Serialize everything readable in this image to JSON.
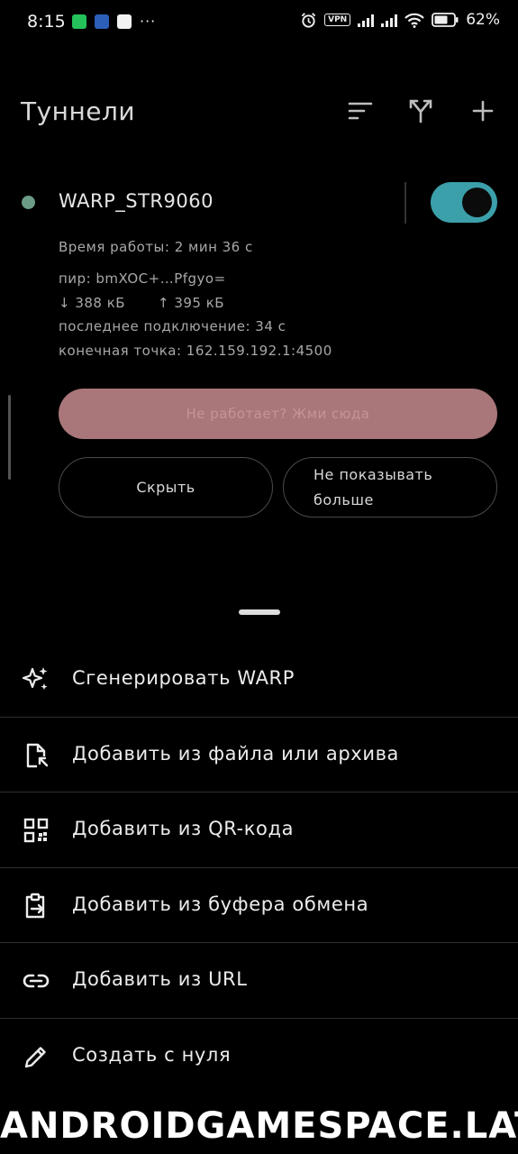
{
  "status_bar": {
    "time": "8:15",
    "notification_icons": [
      "whatsapp-icon",
      "app-icon",
      "notes-icon"
    ],
    "more": "···",
    "vpn": "VPN",
    "battery": "62%"
  },
  "header": {
    "title": "Туннели",
    "actions": [
      "sort-icon",
      "split-icon",
      "add-icon"
    ]
  },
  "tunnel": {
    "name": "WARP_STR9060",
    "status_color": "#6c9b86",
    "enabled": true,
    "uptime": "Время работы: 2 мин 36 с",
    "peer": "пир: bmXOC+…Pfgyo=",
    "rx": "↓ 388 кБ",
    "tx": "↑ 395 кБ",
    "last_handshake": "последнее подключение: 34 с",
    "endpoint": "конечная точка: 162.159.192.1:4500"
  },
  "banner": {
    "cta": "Не работает? Жми сюда",
    "hide": "Скрыть",
    "never_line1": "Не показывать",
    "never_line2": "больше"
  },
  "sheet": {
    "items": [
      {
        "label": "Сгенерировать WARP",
        "icon": "sparkle-icon"
      },
      {
        "label": "Добавить из файла или архива",
        "icon": "file-import-icon"
      },
      {
        "label": "Добавить из QR-кода",
        "icon": "qr-code-icon"
      },
      {
        "label": "Добавить из буфера обмена",
        "icon": "clipboard-icon"
      },
      {
        "label": "Добавить из URL",
        "icon": "link-icon"
      },
      {
        "label": "Создать с нуля",
        "icon": "pencil-icon"
      }
    ]
  },
  "watermark": "ANDROIDGAMESPACE.LAT",
  "colors": {
    "accent": "#3ba0aa",
    "cta_background": "#a9767a",
    "background": "#000000"
  }
}
